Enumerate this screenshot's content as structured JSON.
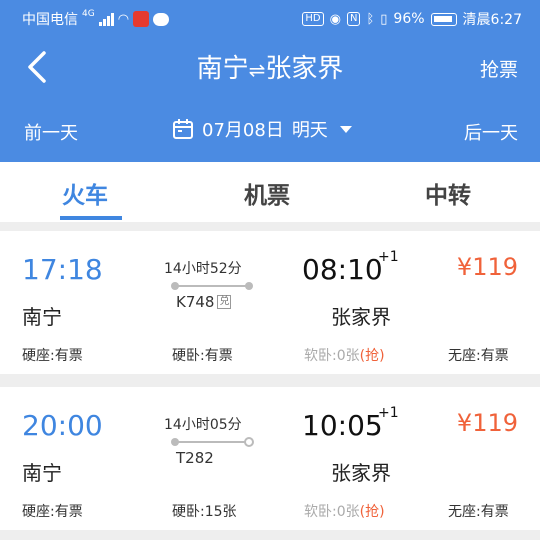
{
  "status_bar": {
    "carrier": "中国电信",
    "network": "4G",
    "battery": "96%",
    "time": "清晨6:27"
  },
  "header": {
    "from": "南宁",
    "arrow": "⇌",
    "to": "张家界",
    "grab_ticket": "抢票",
    "prev_day": "前一天",
    "date": "07月08日",
    "date_relative": "明天",
    "next_day": "后一天"
  },
  "tabs": [
    "火车",
    "机票",
    "中转"
  ],
  "trains": [
    {
      "dep_time": "17:18",
      "arr_time": "08:10",
      "day_offset": "+1",
      "price": "¥119",
      "dep_station": "南宁",
      "arr_station": "张家界",
      "duration": "14小时52分",
      "train_no": "K748",
      "tag": "兑",
      "seats": [
        {
          "label": "硬座:有票",
          "available": true
        },
        {
          "label": "硬卧:有票",
          "available": true
        },
        {
          "label": "软卧:0张",
          "grab": "(抢)",
          "available": false
        },
        {
          "label": "无座:有票",
          "available": true
        }
      ]
    },
    {
      "dep_time": "20:00",
      "arr_time": "10:05",
      "day_offset": "+1",
      "price": "¥119",
      "dep_station": "南宁",
      "arr_station": "张家界",
      "duration": "14小时05分",
      "train_no": "T282",
      "seats": [
        {
          "label": "硬座:有票",
          "available": true
        },
        {
          "label": "硬卧:15张",
          "available": true
        },
        {
          "label": "软卧:0张",
          "grab": "(抢)",
          "available": false
        },
        {
          "label": "无座:有票",
          "available": true
        }
      ]
    }
  ],
  "colors": {
    "header_bg": "#4b8be2",
    "accent": "#3f86e0",
    "price": "#f0623a"
  }
}
